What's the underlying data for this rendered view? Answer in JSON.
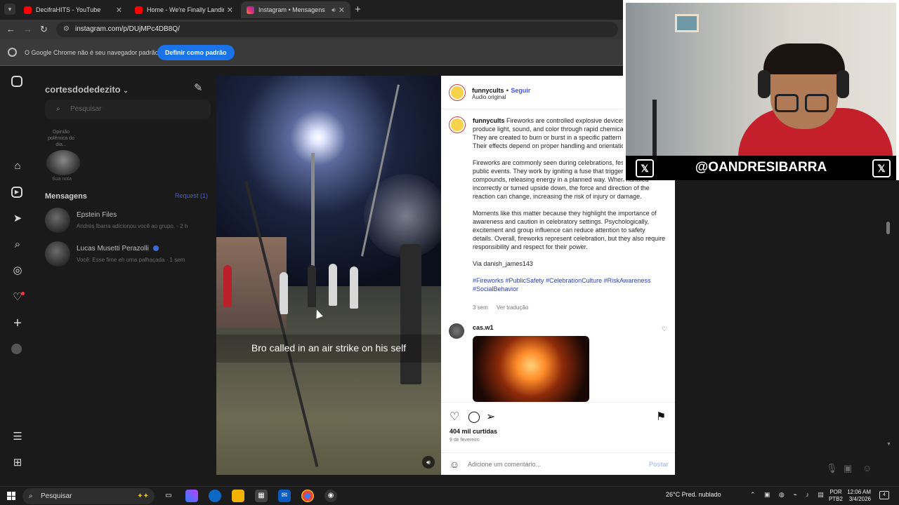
{
  "browser": {
    "tabs": [
      {
        "title": "DecifraHITS - YouTube",
        "icon": "youtube-icon"
      },
      {
        "title": "Home - We're Finally Landing",
        "icon": "youtube-icon"
      },
      {
        "title": "Instagram • Mensagens",
        "icon": "instagram-icon"
      }
    ],
    "url": "instagram.com/p/DUjMPc4DB8Q/",
    "infobar_message": "O Google Chrome não é seu navegador padrão",
    "infobar_button": "Definir como padrão"
  },
  "inbox": {
    "username": "cortesdodedezito",
    "search_placeholder": "Pesquisar",
    "note_text": "Opinião polêmica do dia...",
    "note_label": "Sua nota",
    "section_title": "Mensagens",
    "request_label": "Request (1)",
    "threads": [
      {
        "name": "Epstein Files",
        "snippet": "Andrés Ibarra adicionou você ao grupo. · 2 h"
      },
      {
        "name": "Lucas Musetti Perazolli",
        "snippet": "Você: Esse fime eh uma palhaçada · 1 sem"
      }
    ]
  },
  "post": {
    "video_caption": "Bro called in an air strike on his self",
    "author": "funnycults",
    "follow": "Seguir",
    "separator": "•",
    "audio": "Áudio original",
    "caption_first": "Fireworks are controlled explosive devices designed to produce light, sound, and color through rapid chemical reactions. They are created to burn or burst in a specific pattern and sequence. Their effects depend on proper handling and orientation.",
    "caption_p2": "Fireworks are commonly seen during celebrations, festivals, and public events. They work by igniting a fuse that triggers internal compounds, releasing energy in a planned way. When handled incorrectly or turned upside down, the force and direction of the reaction can change, increasing the risk of injury or damage.",
    "caption_p3": "Moments like this matter because they highlight the importance of awareness and caution in celebratory settings. Psychologically, excitement and group influence can reduce attention to safety details. Overall, fireworks represent celebration, but they also require responsibility and respect for their power.",
    "via": "Via danish_james143",
    "hashtags": "#Fireworks #PublicSafety #CelebrationCulture #RiskAwareness #SocialBehavior",
    "age": "3 sem",
    "translate": "Ver tradução",
    "comment_user": "cas.w1",
    "likes": "404 mil curtidas",
    "date": "9 de fevereiro",
    "comment_placeholder": "Adicione um comentário...",
    "post_button": "Postar"
  },
  "webcam": {
    "handle": "@OANDRESIBARRA"
  },
  "taskbar": {
    "search": "Pesquisar",
    "weather": "26°C  Pred. nublado",
    "lang_top": "POR",
    "lang_bottom": "PTB2",
    "time": "12:06 AM",
    "date": "3/4/2026",
    "notifications": "4"
  },
  "colors": {
    "accent_blue": "#1a73e8",
    "instagram_link": "#4150f7",
    "notification_dot": "#ff3040"
  }
}
